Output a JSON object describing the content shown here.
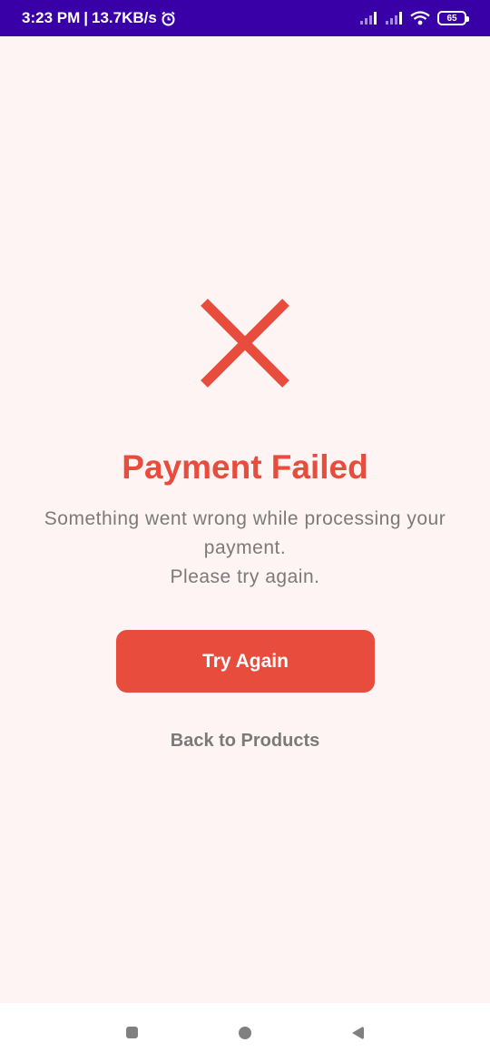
{
  "status_bar": {
    "time": "3:23 PM",
    "separator": "|",
    "network_speed": "13.7KB/s",
    "battery_level": "65",
    "icons": [
      "alarm-icon",
      "signal-icon",
      "signal-icon",
      "wifi-icon",
      "battery-icon"
    ],
    "background_color": "#3a00a8"
  },
  "main": {
    "icon": "close-icon",
    "title": "Payment Failed",
    "message_line1": "Something went wrong while processing your payment.",
    "message_line2": "Please try again.",
    "try_again_label": "Try Again",
    "back_label": "Back to Products",
    "accent_color": "#e74c3c"
  },
  "nav_bar": {
    "icons": [
      "recents-icon",
      "home-icon",
      "back-icon"
    ]
  }
}
